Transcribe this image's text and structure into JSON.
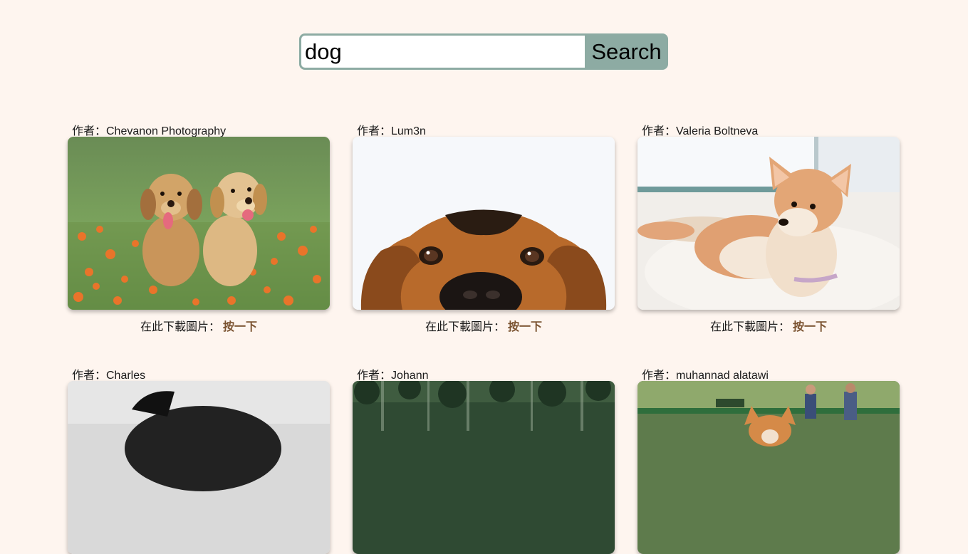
{
  "search": {
    "value": "dog",
    "button_label": "Search"
  },
  "results": [
    {
      "author": "作者：Chevanon Photography",
      "download_label": "在此下載圖片：",
      "download_link": "按一下",
      "photo_icon": "golden-retriever-puppies-photo"
    },
    {
      "author": "作者：Lum3n",
      "download_label": "在此下載圖片：",
      "download_link": "按一下",
      "photo_icon": "dog-peeking-photo"
    },
    {
      "author": "作者：Valeria Boltneva",
      "download_label": "在此下載圖片：",
      "download_link": "按一下",
      "photo_icon": "shiba-inu-photo"
    },
    {
      "author": "作者：Charles",
      "photo_icon": "black-dog-photo"
    },
    {
      "author": "作者：Johann",
      "photo_icon": "forest-photo"
    },
    {
      "author": "作者：muhannad alatawi",
      "photo_icon": "corgi-in-park-photo"
    }
  ]
}
